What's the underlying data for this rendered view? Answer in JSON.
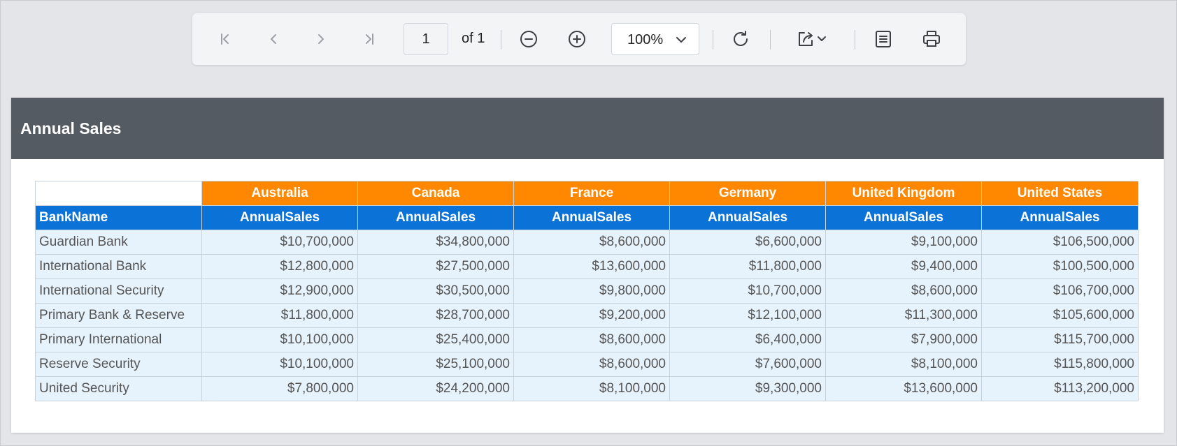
{
  "toolbar": {
    "page_current": "1",
    "page_total": "of 1",
    "zoom_value": "100%",
    "buttons": {
      "first": "first-page-icon",
      "prev": "previous-page-icon",
      "next": "next-page-icon",
      "last": "last-page-icon",
      "zoom_out": "zoom-out-icon",
      "zoom_in": "zoom-in-icon",
      "refresh": "refresh-icon",
      "export": "export-icon",
      "parameters": "document-icon",
      "print": "print-icon"
    }
  },
  "report": {
    "title": "Annual Sales",
    "header_color": "#555b63",
    "country_header_color": "#ff8800",
    "metric_header_color": "#0b73d8",
    "row_color": "#e6f2fc",
    "bank_header": "BankName",
    "countries": [
      "Australia",
      "Canada",
      "France",
      "Germany",
      "United Kingdom",
      "United States"
    ],
    "metric_label": "AnnualSales",
    "rows": [
      {
        "bank": "Guardian Bank",
        "values": [
          "$10,700,000",
          "$34,800,000",
          "$8,600,000",
          "$6,600,000",
          "$9,100,000",
          "$106,500,000"
        ]
      },
      {
        "bank": "International Bank",
        "values": [
          "$12,800,000",
          "$27,500,000",
          "$13,600,000",
          "$11,800,000",
          "$9,400,000",
          "$100,500,000"
        ]
      },
      {
        "bank": "International Security",
        "values": [
          "$12,900,000",
          "$30,500,000",
          "$9,800,000",
          "$10,700,000",
          "$8,600,000",
          "$106,700,000"
        ]
      },
      {
        "bank": "Primary Bank & Reserve",
        "values": [
          "$11,800,000",
          "$28,700,000",
          "$9,200,000",
          "$12,100,000",
          "$11,300,000",
          "$105,600,000"
        ]
      },
      {
        "bank": "Primary International",
        "values": [
          "$10,100,000",
          "$25,400,000",
          "$8,600,000",
          "$6,400,000",
          "$7,900,000",
          "$115,700,000"
        ]
      },
      {
        "bank": "Reserve Security",
        "values": [
          "$10,100,000",
          "$25,100,000",
          "$8,600,000",
          "$7,600,000",
          "$8,100,000",
          "$115,800,000"
        ]
      },
      {
        "bank": "United Security",
        "values": [
          "$7,800,000",
          "$24,200,000",
          "$8,100,000",
          "$9,300,000",
          "$13,600,000",
          "$113,200,000"
        ]
      }
    ]
  }
}
